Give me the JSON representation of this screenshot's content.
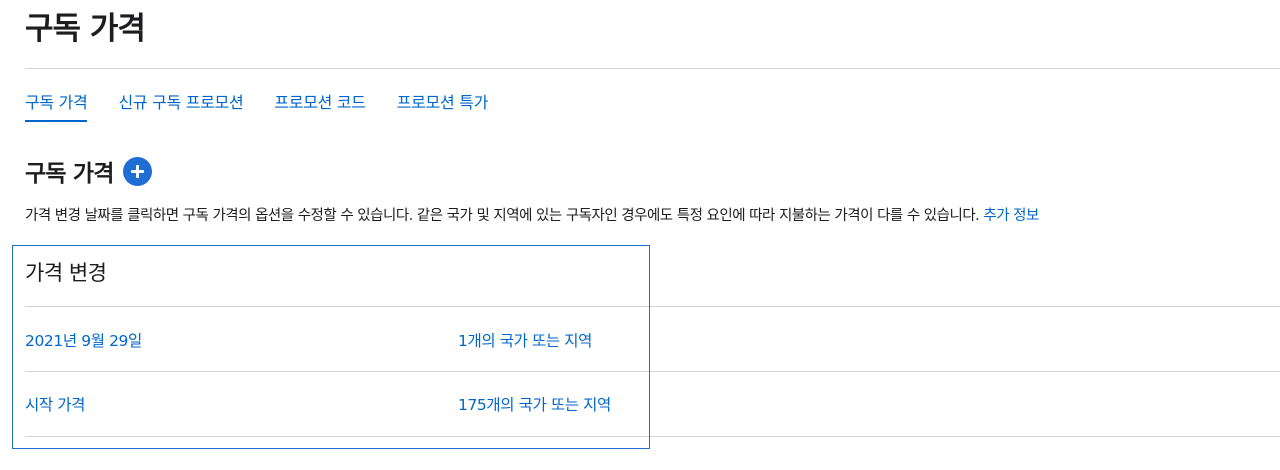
{
  "page": {
    "title": "구독 가격"
  },
  "tabs": [
    {
      "label": "구독 가격",
      "active": true
    },
    {
      "label": "신규 구독 프로모션",
      "active": false
    },
    {
      "label": "프로모션 코드",
      "active": false
    },
    {
      "label": "프로모션 특가",
      "active": false
    }
  ],
  "section": {
    "title": "구독 가격",
    "add_icon": "plus-circle-icon",
    "description": "가격 변경 날짜를 클릭하면 구독 가격의 옵션을 수정할 수 있습니다. 같은 국가 및 지역에 있는 구독자인 경우에도 특정 요인에 따라 지불하는 가격이 다를 수 있습니다.",
    "more_link": "추가 정보"
  },
  "price_changes": {
    "header": "가격 변경",
    "rows": [
      {
        "date": "2021년 9월 29일",
        "regions": "1개의 국가 또는 지역"
      },
      {
        "date": "시작 가격",
        "regions": "175개의 국가 또는 지역"
      }
    ]
  },
  "colors": {
    "accent": "#0066cc",
    "add_button": "#1f6ed4",
    "divider": "#d2d2d7",
    "text": "#1d1d1f"
  }
}
